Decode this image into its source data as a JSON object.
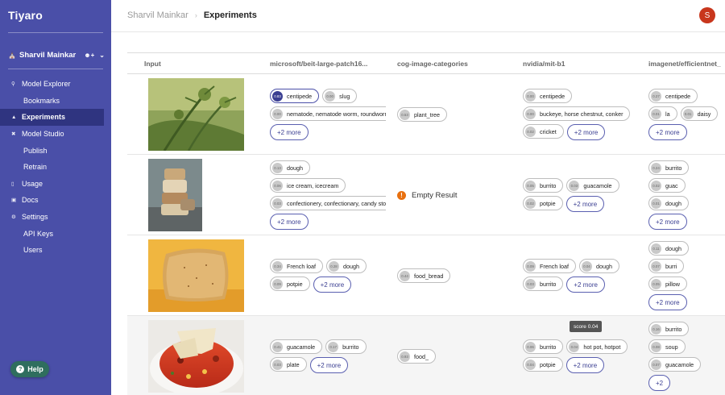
{
  "app": {
    "name": "Tiyaro"
  },
  "account": {
    "name": "Sharvil Mainkar"
  },
  "nav": [
    {
      "label": "Model Explorer",
      "icon": "search-icon",
      "sub": false,
      "active": false
    },
    {
      "label": "Bookmarks",
      "icon": "",
      "sub": true,
      "active": false
    },
    {
      "label": "Experiments",
      "icon": "flask-icon",
      "sub": false,
      "active": true
    },
    {
      "label": "Model Studio",
      "icon": "tools-icon",
      "sub": false,
      "active": false
    },
    {
      "label": "Publish",
      "icon": "",
      "sub": true,
      "active": false
    },
    {
      "label": "Retrain",
      "icon": "",
      "sub": true,
      "active": false
    },
    {
      "label": "Usage",
      "icon": "chart-icon",
      "sub": false,
      "active": false
    },
    {
      "label": "Docs",
      "icon": "book-icon",
      "sub": false,
      "active": false
    },
    {
      "label": "Settings",
      "icon": "gear-icon",
      "sub": false,
      "active": false
    },
    {
      "label": "API Keys",
      "icon": "",
      "sub": true,
      "active": false
    },
    {
      "label": "Users",
      "icon": "",
      "sub": true,
      "active": false
    }
  ],
  "help": {
    "label": "Help"
  },
  "breadcrumb": {
    "parent": "Sharvil Mainkar",
    "current": "Experiments"
  },
  "user": {
    "initial": "S",
    "color": "#c8361c"
  },
  "columns": [
    "Input",
    "microsoft/beit-large-patch16...",
    "cog-image-categories",
    "nvidia/mit-b1",
    "imagenet/efficientnet_"
  ],
  "rows": [
    {
      "image": "plant",
      "beit": {
        "chips": [
          {
            "score": "0.83",
            "label": "centipede",
            "sel": true
          },
          {
            "score": "0.00",
            "label": "slug"
          },
          {
            "score": "0.00",
            "label": "nematode, nematode worm, roundworm"
          }
        ],
        "more": "+2 more"
      },
      "cog": {
        "chips": [
          {
            "score": "0.53",
            "label": "plant_tree"
          }
        ],
        "more": "",
        "empty": ""
      },
      "mit": {
        "chips": [
          {
            "score": "0.00",
            "label": "centipede"
          },
          {
            "score": "0.00",
            "label": "buckeye, horse chestnut, conker"
          },
          {
            "score": "0.02",
            "label": "cricket"
          }
        ],
        "more": "+2 more"
      },
      "eff": {
        "chips": [
          {
            "score": "0.27",
            "label": "centipede"
          },
          {
            "score": "0.01",
            "label": "la"
          },
          {
            "score": "0.01",
            "label": "daisy"
          }
        ],
        "more": "+2 more"
      }
    },
    {
      "image": "stack",
      "beit": {
        "chips": [
          {
            "score": "0.13",
            "label": "dough"
          },
          {
            "score": "0.06",
            "label": "ice cream, icecream"
          },
          {
            "score": "0.03",
            "label": "confectionery, confectionary, candy store"
          }
        ],
        "more": "+2 more"
      },
      "cog": {
        "chips": [],
        "more": "",
        "empty": "Empty Result"
      },
      "mit": {
        "chips": [
          {
            "score": "0.05",
            "label": "burrito"
          },
          {
            "score": "0.03",
            "label": "guacamole"
          },
          {
            "score": "0.02",
            "label": "potpie"
          }
        ],
        "more": "+2 more"
      },
      "eff": {
        "chips": [
          {
            "score": "0.24",
            "label": "burrito"
          },
          {
            "score": "0.02",
            "label": "guac"
          },
          {
            "score": "0.01",
            "label": "dough"
          }
        ],
        "more": "+2 more"
      }
    },
    {
      "image": "bread",
      "beit": {
        "chips": [
          {
            "score": "0.34",
            "label": "French loaf"
          },
          {
            "score": "0.28",
            "label": "dough"
          },
          {
            "score": "0.09",
            "label": "potpie"
          }
        ],
        "more": "+2 more"
      },
      "cog": {
        "chips": [
          {
            "score": "0.44",
            "label": "food_bread"
          }
        ],
        "more": "",
        "empty": ""
      },
      "mit": {
        "chips": [
          {
            "score": "0.09",
            "label": "French loaf"
          },
          {
            "score": "0.04",
            "label": "dough"
          },
          {
            "score": "0.03",
            "label": "burrito"
          }
        ],
        "more": "+2 more"
      },
      "eff": {
        "chips": [
          {
            "score": "0.11",
            "label": "dough"
          },
          {
            "score": "0.07",
            "label": "burri"
          },
          {
            "score": "0.05",
            "label": "pillow"
          }
        ],
        "more": "+2 more"
      }
    },
    {
      "image": "salsa",
      "beit": {
        "chips": [
          {
            "score": "0.41",
            "label": "guacamole"
          },
          {
            "score": "0.17",
            "label": "burrito"
          },
          {
            "score": "0.03",
            "label": "plate"
          }
        ],
        "more": "+2 more"
      },
      "cog": {
        "chips": [
          {
            "score": "0.93",
            "label": "food_"
          }
        ],
        "more": "",
        "empty": ""
      },
      "mit": {
        "chips": [
          {
            "score": "0.06",
            "label": "burrito"
          },
          {
            "score": "0.04",
            "label": "hot pot, hotpot"
          },
          {
            "score": "0.04",
            "label": "potpie"
          }
        ],
        "more": "+2 more"
      },
      "eff": {
        "chips": [
          {
            "score": "0.16",
            "label": "burrito"
          },
          {
            "score": "0.08",
            "label": "soup"
          },
          {
            "score": "0.07",
            "label": "guacamole"
          }
        ],
        "more": "+2"
      }
    }
  ],
  "tooltip": {
    "text": "score 0.04"
  }
}
